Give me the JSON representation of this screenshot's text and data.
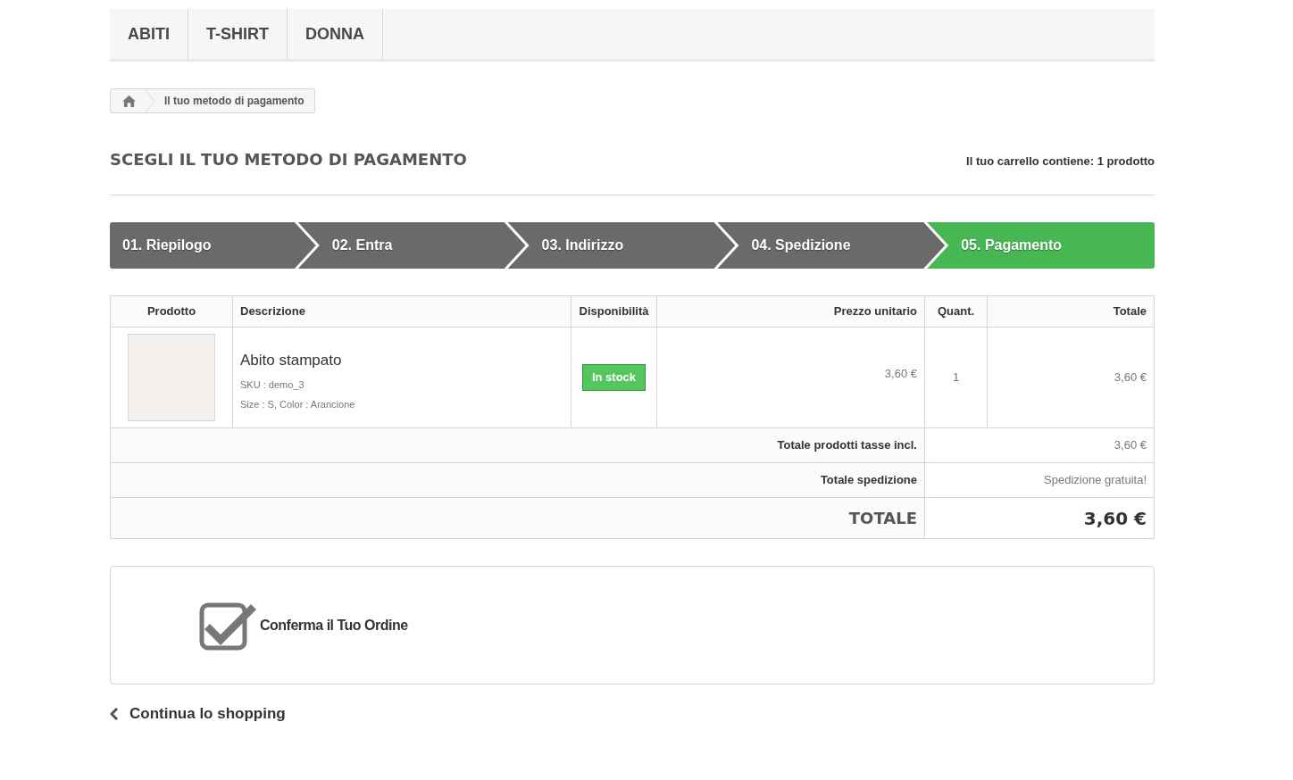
{
  "menu": [
    {
      "label": "ABITI"
    },
    {
      "label": "T-SHIRT"
    },
    {
      "label": "DONNA"
    }
  ],
  "breadcrumb": {
    "current": "Il tuo metodo di pagamento"
  },
  "page_title": "SCEGLI IL TUO METODO DI PAGAMENTO",
  "cart_summary": "Il tuo carrello contiene: 1 prodotto",
  "steps": [
    {
      "label": "01. Riepilogo",
      "selected": false
    },
    {
      "label": "02. Entra",
      "selected": false
    },
    {
      "label": "03. Indirizzo",
      "selected": false
    },
    {
      "label": "04. Spedizione",
      "selected": false
    },
    {
      "label": "05. Pagamento",
      "selected": true
    }
  ],
  "table": {
    "columns": [
      "Prodotto",
      "Descrizione",
      "Disponibilità",
      "Prezzo unitario",
      "Quant.",
      "Totale"
    ],
    "rows": [
      {
        "name": "Abito stampato",
        "sku": "SKU : demo_3",
        "attributes": "Size : S, Color : Arancione",
        "availability": "In stock",
        "unit_price": "3,60 €",
        "quantity": "1",
        "total": "3,60 €"
      }
    ],
    "totals": [
      {
        "label": "Totale prodotti tasse incl.",
        "value": "3,60 €",
        "kind": "normal"
      },
      {
        "label": "Totale spedizione",
        "value": "Spedizione gratuita!",
        "kind": "normal"
      },
      {
        "label": "TOTALE",
        "value": "3,60 €",
        "kind": "grand"
      }
    ]
  },
  "payment_option": {
    "label": "Conferma il Tuo Ordine"
  },
  "continue_link": {
    "label": "Continua lo shopping"
  }
}
